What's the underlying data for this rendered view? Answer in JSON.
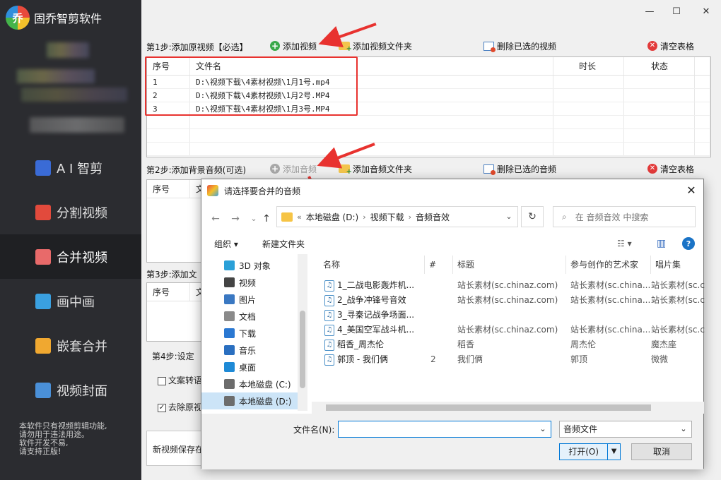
{
  "app": {
    "logo_glyph": "乔",
    "name": "固乔智剪软件"
  },
  "sidebar": {
    "items": [
      {
        "label": "A I 智剪",
        "icon": "ai-wand-icon",
        "color": "#3a6bd6"
      },
      {
        "label": "分割视频",
        "icon": "split-video-icon",
        "color": "#e24a3c"
      },
      {
        "label": "合并视频",
        "icon": "merge-video-icon",
        "color": "#e86a6a"
      },
      {
        "label": "画中画",
        "icon": "picture-in-picture-icon",
        "color": "#3aa0e0"
      },
      {
        "label": "嵌套合并",
        "icon": "nested-merge-icon",
        "color": "#f0a830"
      },
      {
        "label": "视频封面",
        "icon": "video-cover-icon",
        "color": "#4a90d8"
      }
    ],
    "active_index": 2,
    "note_lines": [
      "本软件只有视频剪辑功能,",
      "请勿用于违法用途。",
      "软件开发不易,",
      "请支持正版!"
    ]
  },
  "window": {
    "minimize": "—",
    "maximize": "☐",
    "close": "✕"
  },
  "step1": {
    "label": "第1步:添加原视频【必选】",
    "add_video": "添加视频",
    "add_folder": "添加视频文件夹",
    "delete_selected": "删除已选的视频",
    "clear": "清空表格",
    "columns": [
      "序号",
      "文件名",
      "时长",
      "状态"
    ],
    "rows": [
      {
        "index": "1",
        "file": "D:\\视频下载\\4素材视频\\1月1号.mp4"
      },
      {
        "index": "2",
        "file": "D:\\视频下载\\4素材视频\\1月2号.MP4"
      },
      {
        "index": "3",
        "file": "D:\\视频下载\\4素材视频\\1月3号.MP4"
      }
    ]
  },
  "step2": {
    "label": "第2步:添加背景音频(可选)",
    "add_audio": "添加音频",
    "add_folder": "添加音频文件夹",
    "delete_selected": "删除已选的音频",
    "clear": "清空表格",
    "col_index": "序号",
    "col_file_partial": "文"
  },
  "step3": {
    "label": "第3步:添加文",
    "col_index": "序号",
    "col_file_partial": "文"
  },
  "step4": {
    "label": "第4步:设定",
    "option1": "文案转语",
    "option2": "去除原视",
    "save_label": "新视频保存在"
  },
  "dialog": {
    "title": "请选择要合并的音频",
    "close": "✕",
    "address": {
      "root": "本地磁盘 (D:)",
      "folder1": "视频下载",
      "folder2": "音频音效",
      "prefix": "«"
    },
    "search_placeholder": "在 音频音效 中搜索",
    "organize": "组织 ▾",
    "new_folder": "新建文件夹",
    "tree": [
      {
        "label": "3D 对象",
        "icon": "3d-objects-icon",
        "color": "#2aa0d8"
      },
      {
        "label": "视频",
        "icon": "videos-icon",
        "color": "#444444"
      },
      {
        "label": "图片",
        "icon": "pictures-icon",
        "color": "#3a78c2"
      },
      {
        "label": "文档",
        "icon": "documents-icon",
        "color": "#8a8a8a"
      },
      {
        "label": "下载",
        "icon": "downloads-icon",
        "color": "#2a78d2"
      },
      {
        "label": "音乐",
        "icon": "music-icon",
        "color": "#2a6fc0"
      },
      {
        "label": "桌面",
        "icon": "desktop-icon",
        "color": "#1e8ad6"
      },
      {
        "label": "本地磁盘 (C:)",
        "icon": "drive-c-icon",
        "color": "#6c6c6c"
      },
      {
        "label": "本地磁盘 (D:)",
        "icon": "drive-d-icon",
        "color": "#6c6c6c"
      }
    ],
    "tree_selected_index": 8,
    "columns": [
      "名称",
      "#",
      "标题",
      "参与创作的艺术家",
      "唱片集"
    ],
    "files": [
      {
        "name": "1_二战电影轰炸机...",
        "num": "",
        "title": "站长素材(sc.chinaz.com)",
        "artist": "站长素材(sc.china...",
        "album": "站长素材(sc.c"
      },
      {
        "name": "2_战争冲锋号音效",
        "num": "",
        "title": "站长素材(sc.chinaz.com)",
        "artist": "站长素材(sc.china...",
        "album": "站长素材(sc.c"
      },
      {
        "name": "3_寻秦记战争场面...",
        "num": "",
        "title": "",
        "artist": "",
        "album": ""
      },
      {
        "name": "4_美国空军战斗机...",
        "num": "",
        "title": "站长素材(sc.chinaz.com)",
        "artist": "站长素材(sc.china...",
        "album": "站长素材(sc.c"
      },
      {
        "name": "稻香_周杰伦",
        "num": "",
        "title": "稻香",
        "artist": "周杰伦",
        "album": "魔杰座"
      },
      {
        "name": "郭顶 - 我们俩",
        "num": "2",
        "title": "我们俩",
        "artist": "郭顶",
        "album": "微微"
      }
    ],
    "filename_label": "文件名(N):",
    "filename_value": "",
    "filetype": "音频文件",
    "open": "打开(O)",
    "cancel": "取消"
  },
  "colors": {
    "sidebar_bg": "#2b2c30",
    "highlight_red": "#e8322f",
    "accent_blue": "#0078d7"
  }
}
